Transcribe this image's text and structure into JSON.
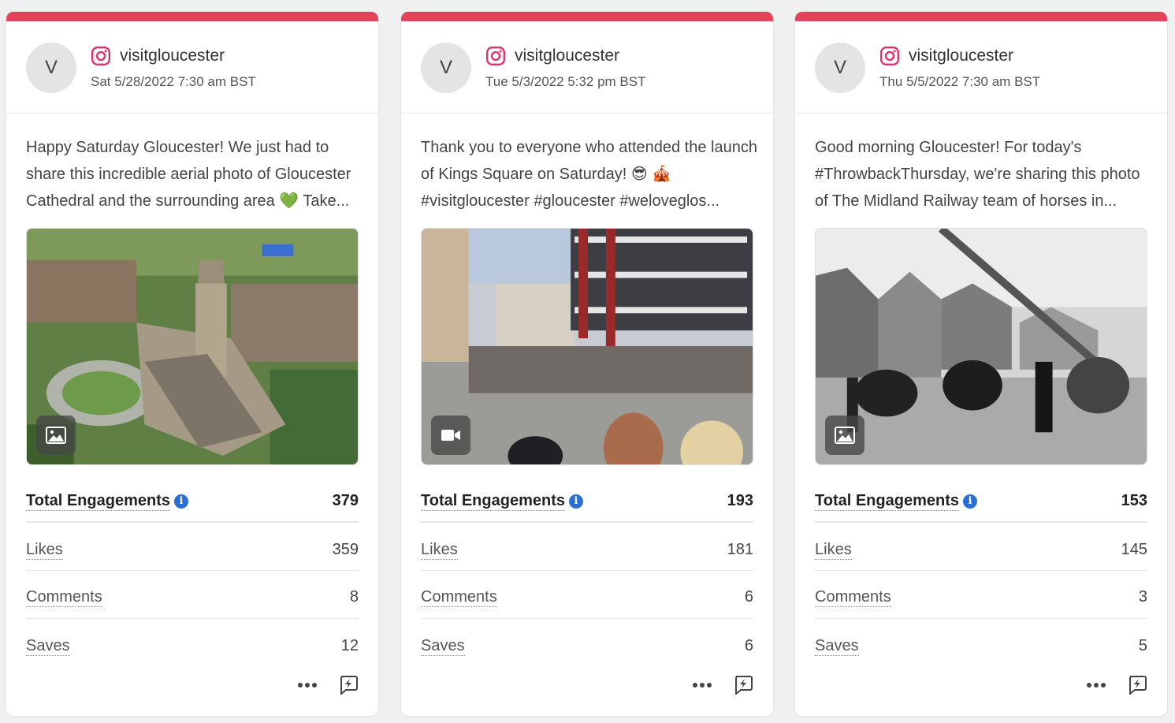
{
  "colors": {
    "accent_bar": "#e3435a",
    "info_icon": "#2a6fd6",
    "instagram": "#e1306c"
  },
  "posts": [
    {
      "avatar_initial": "V",
      "network_icon": "instagram-icon",
      "account": "visitgloucester",
      "date": "Sat 5/28/2022 7:30 am BST",
      "caption": "Happy Saturday Gloucester! We just had to share this incredible aerial photo of Gloucester Cathedral and the surrounding area 💚 Take...",
      "media_type": "image",
      "metrics": {
        "total_label": "Total Engagements",
        "total": "379",
        "likes_label": "Likes",
        "likes": "359",
        "comments_label": "Comments",
        "comments": "8",
        "saves_label": "Saves",
        "saves": "12"
      }
    },
    {
      "avatar_initial": "V",
      "network_icon": "instagram-icon",
      "account": "visitgloucester",
      "date": "Tue 5/3/2022 5:32 pm BST",
      "caption": "Thank you to everyone who attended the launch of Kings Square on Saturday! 😎 🎪 #visitgloucester #gloucester #weloveglos...",
      "media_type": "video",
      "metrics": {
        "total_label": "Total Engagements",
        "total": "193",
        "likes_label": "Likes",
        "likes": "181",
        "comments_label": "Comments",
        "comments": "6",
        "saves_label": "Saves",
        "saves": "6"
      }
    },
    {
      "avatar_initial": "V",
      "network_icon": "instagram-icon",
      "account": "visitgloucester",
      "date": "Thu 5/5/2022 7:30 am BST",
      "caption": "Good morning Gloucester! For today's #ThrowbackThursday, we're sharing this photo of The Midland Railway team of horses in...",
      "media_type": "image",
      "metrics": {
        "total_label": "Total Engagements",
        "total": "153",
        "likes_label": "Likes",
        "likes": "145",
        "comments_label": "Comments",
        "comments": "3",
        "saves_label": "Saves",
        "saves": "5"
      }
    }
  ]
}
